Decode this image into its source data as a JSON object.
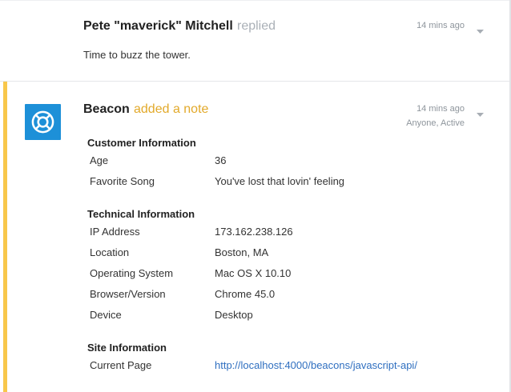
{
  "reply": {
    "author": "Pete \"maverick\" Mitchell",
    "action": "replied",
    "time": "14 mins ago",
    "body": "Time to buzz the tower."
  },
  "note": {
    "author": "Beacon",
    "action": "added a note",
    "time": "14 mins ago",
    "visibility": "Anyone, Active",
    "avatar_icon": "lifebuoy-icon",
    "accent_color": "#f8c74b",
    "avatar_color": "#1d90d8",
    "sections": [
      {
        "title": "Customer Information",
        "rows": [
          {
            "label": "Age",
            "value": "36"
          },
          {
            "label": "Favorite Song",
            "value": "You've lost that lovin' feeling"
          }
        ]
      },
      {
        "title": "Technical Information",
        "rows": [
          {
            "label": "IP Address",
            "value": "173.162.238.126"
          },
          {
            "label": "Location",
            "value": "Boston, MA"
          },
          {
            "label": "Operating System",
            "value": "Mac OS X 10.10"
          },
          {
            "label": "Browser/Version",
            "value": "Chrome 45.0"
          },
          {
            "label": "Device",
            "value": "Desktop"
          }
        ]
      },
      {
        "title": "Site Information",
        "rows": [
          {
            "label": "Current Page",
            "value": "http://localhost:4000/beacons/javascript-api/"
          }
        ]
      }
    ]
  }
}
